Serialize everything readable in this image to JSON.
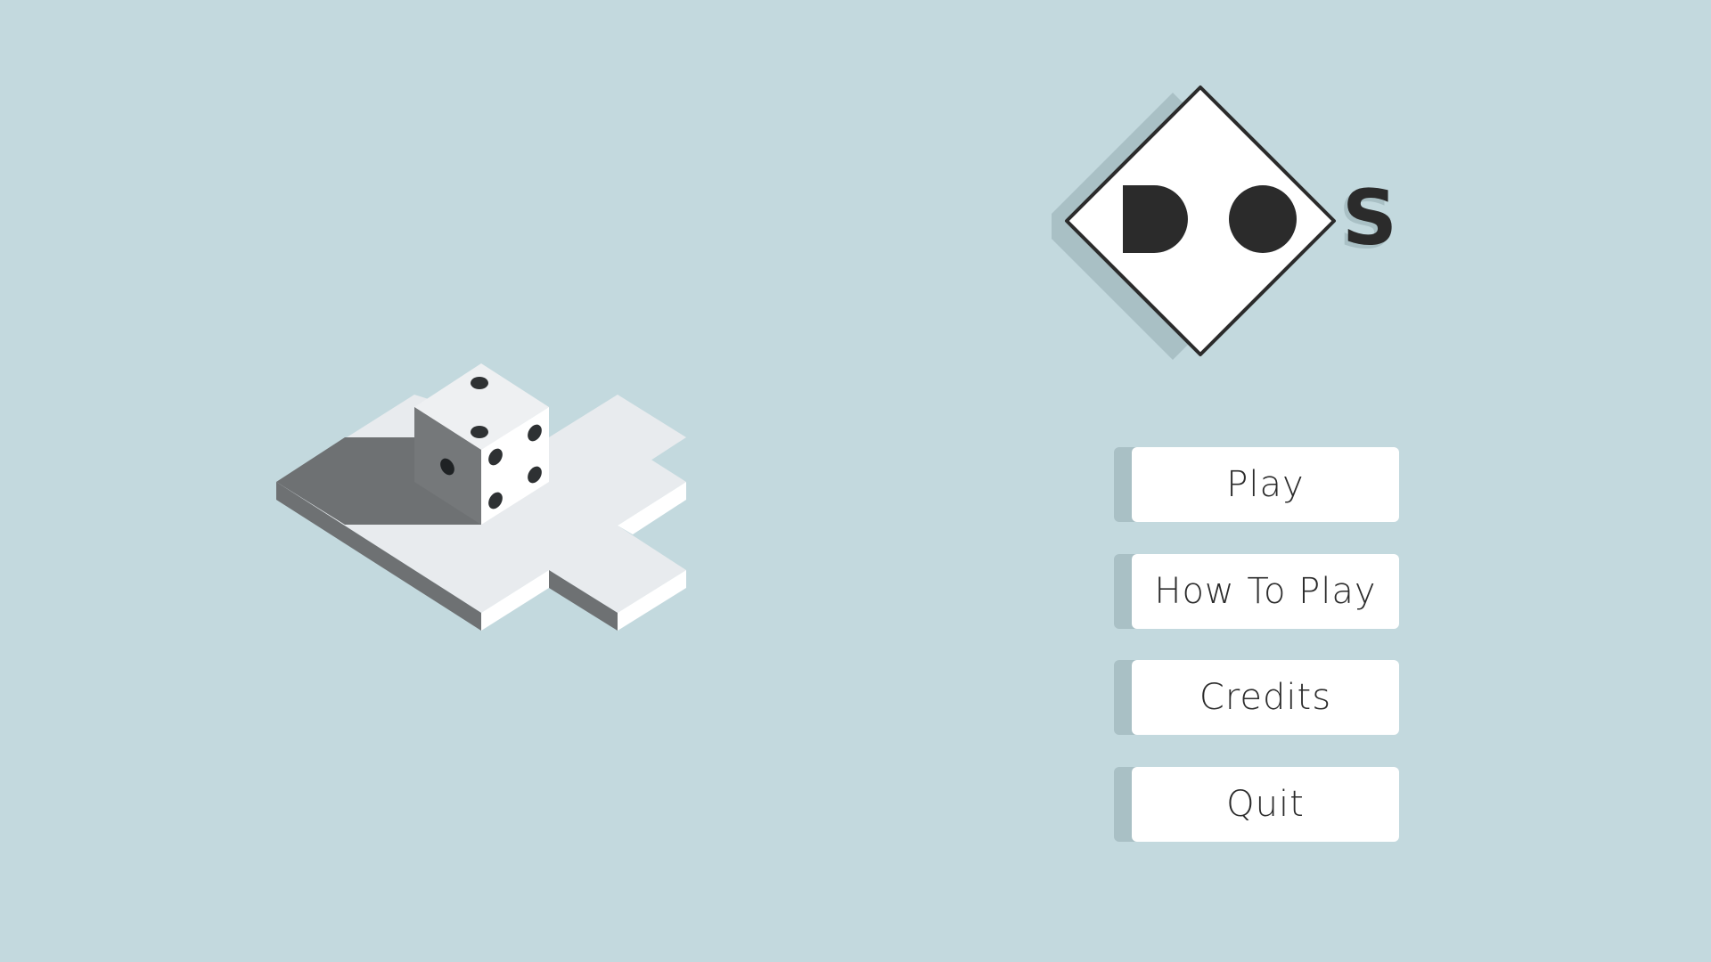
{
  "game": {
    "logo": {
      "letters": [
        "D",
        "O",
        "S"
      ],
      "colors": {
        "ink": "#2b2b2b",
        "diamond_fill": "#ffffff",
        "shadow": "#a9c0c5"
      }
    },
    "menu": {
      "items": [
        {
          "label": "Play"
        },
        {
          "label": "How To Play"
        },
        {
          "label": "Credits"
        },
        {
          "label": "Quit"
        }
      ]
    },
    "board": {
      "die_faces_visible": {
        "top": 1,
        "front_left": 1,
        "front_right": 4
      }
    }
  },
  "colors": {
    "background": "#c3d9de",
    "tile_top": "#e8ebee",
    "tile_side_light": "#ffffff",
    "tile_side_dark": "#6e7173",
    "button_face": "#ffffff",
    "button_shadow": "#a9c0c5",
    "pip": "#2e3133"
  }
}
